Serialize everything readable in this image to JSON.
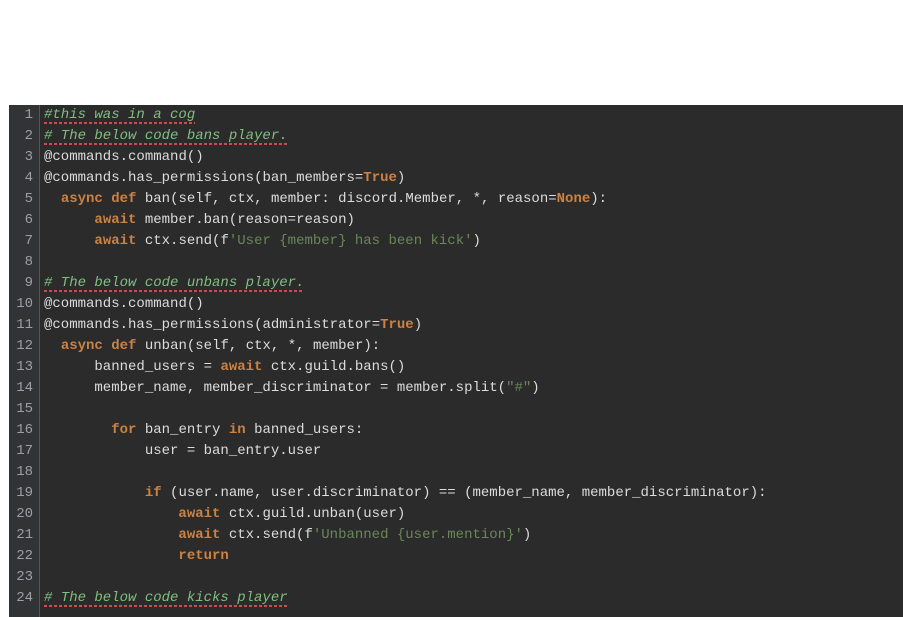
{
  "editor": {
    "total_lines": 24,
    "lines": [
      {
        "num": 1,
        "segments": [
          {
            "cls": "tok-comment squiggle",
            "text": "#this was in a cog"
          }
        ]
      },
      {
        "num": 2,
        "segments": [
          {
            "cls": "tok-comment squiggle",
            "text": "# The below code bans player."
          }
        ]
      },
      {
        "num": 3,
        "segments": [
          {
            "cls": "tok-decor2",
            "text": "@commands"
          },
          {
            "cls": "tok-punct",
            "text": "."
          },
          {
            "cls": "tok-def",
            "text": "command"
          },
          {
            "cls": "tok-punct",
            "text": "()"
          }
        ]
      },
      {
        "num": 4,
        "segments": [
          {
            "cls": "tok-decor2",
            "text": "@commands"
          },
          {
            "cls": "tok-punct",
            "text": "."
          },
          {
            "cls": "tok-def",
            "text": "has_permissions"
          },
          {
            "cls": "tok-punct",
            "text": "("
          },
          {
            "cls": "tok-param",
            "text": "ban_members"
          },
          {
            "cls": "tok-punct",
            "text": "="
          },
          {
            "cls": "tok-kw",
            "text": "True"
          },
          {
            "cls": "tok-punct",
            "text": ")"
          }
        ]
      },
      {
        "num": 5,
        "segments": [
          {
            "cls": "",
            "text": "  "
          },
          {
            "cls": "tok-kw",
            "text": "async"
          },
          {
            "cls": "",
            "text": " "
          },
          {
            "cls": "tok-kw",
            "text": "def"
          },
          {
            "cls": "",
            "text": " "
          },
          {
            "cls": "tok-def",
            "text": "ban"
          },
          {
            "cls": "tok-punct",
            "text": "("
          },
          {
            "cls": "tok-param",
            "text": "self"
          },
          {
            "cls": "tok-punct",
            "text": ", "
          },
          {
            "cls": "tok-param",
            "text": "ctx"
          },
          {
            "cls": "tok-punct",
            "text": ", "
          },
          {
            "cls": "tok-param",
            "text": "member"
          },
          {
            "cls": "tok-punct",
            "text": ": "
          },
          {
            "cls": "tok-def",
            "text": "discord.Member"
          },
          {
            "cls": "tok-punct",
            "text": ", *, "
          },
          {
            "cls": "tok-param",
            "text": "reason"
          },
          {
            "cls": "tok-punct",
            "text": "="
          },
          {
            "cls": "tok-kw",
            "text": "None"
          },
          {
            "cls": "tok-punct",
            "text": "):"
          }
        ]
      },
      {
        "num": 6,
        "segments": [
          {
            "cls": "",
            "text": "      "
          },
          {
            "cls": "tok-kw",
            "text": "await"
          },
          {
            "cls": "",
            "text": " member.ban(reason=reason)"
          }
        ]
      },
      {
        "num": 7,
        "segments": [
          {
            "cls": "",
            "text": "      "
          },
          {
            "cls": "tok-kw",
            "text": "await"
          },
          {
            "cls": "",
            "text": " ctx.send("
          },
          {
            "cls": "tok-punct",
            "text": "f"
          },
          {
            "cls": "tok-str",
            "text": "'User {member} has been kick'"
          },
          {
            "cls": "",
            "text": ")"
          }
        ]
      },
      {
        "num": 8,
        "segments": []
      },
      {
        "num": 9,
        "segments": [
          {
            "cls": "tok-comment squiggle",
            "text": "# The below code unbans player."
          }
        ]
      },
      {
        "num": 10,
        "segments": [
          {
            "cls": "tok-decor2",
            "text": "@commands"
          },
          {
            "cls": "tok-punct",
            "text": "."
          },
          {
            "cls": "tok-def",
            "text": "command"
          },
          {
            "cls": "tok-punct",
            "text": "()"
          }
        ]
      },
      {
        "num": 11,
        "segments": [
          {
            "cls": "tok-decor2",
            "text": "@commands"
          },
          {
            "cls": "tok-punct",
            "text": "."
          },
          {
            "cls": "tok-def",
            "text": "has_permissions"
          },
          {
            "cls": "tok-punct",
            "text": "("
          },
          {
            "cls": "tok-param",
            "text": "administrator"
          },
          {
            "cls": "tok-punct",
            "text": "="
          },
          {
            "cls": "tok-kw",
            "text": "True"
          },
          {
            "cls": "tok-punct",
            "text": ")"
          }
        ]
      },
      {
        "num": 12,
        "segments": [
          {
            "cls": "",
            "text": "  "
          },
          {
            "cls": "tok-kw",
            "text": "async"
          },
          {
            "cls": "",
            "text": " "
          },
          {
            "cls": "tok-kw",
            "text": "def"
          },
          {
            "cls": "",
            "text": " "
          },
          {
            "cls": "tok-def",
            "text": "unban"
          },
          {
            "cls": "tok-punct",
            "text": "("
          },
          {
            "cls": "tok-param",
            "text": "self"
          },
          {
            "cls": "tok-punct",
            "text": ", "
          },
          {
            "cls": "tok-param",
            "text": "ctx"
          },
          {
            "cls": "tok-punct",
            "text": ", *, "
          },
          {
            "cls": "tok-param",
            "text": "member"
          },
          {
            "cls": "tok-punct",
            "text": "):"
          }
        ]
      },
      {
        "num": 13,
        "segments": [
          {
            "cls": "",
            "text": "      banned_users = "
          },
          {
            "cls": "tok-kw",
            "text": "await"
          },
          {
            "cls": "",
            "text": " ctx.guild.bans()"
          }
        ]
      },
      {
        "num": 14,
        "segments": [
          {
            "cls": "",
            "text": "      member_name, member_discriminator = member.split("
          },
          {
            "cls": "tok-str",
            "text": "\"#\""
          },
          {
            "cls": "",
            "text": ")"
          }
        ]
      },
      {
        "num": 15,
        "segments": []
      },
      {
        "num": 16,
        "segments": [
          {
            "cls": "",
            "text": "        "
          },
          {
            "cls": "tok-kw",
            "text": "for"
          },
          {
            "cls": "",
            "text": " ban_entry "
          },
          {
            "cls": "tok-kw",
            "text": "in"
          },
          {
            "cls": "",
            "text": " banned_users:"
          }
        ]
      },
      {
        "num": 17,
        "segments": [
          {
            "cls": "",
            "text": "            user = ban_entry.user"
          }
        ]
      },
      {
        "num": 18,
        "segments": []
      },
      {
        "num": 19,
        "segments": [
          {
            "cls": "",
            "text": "            "
          },
          {
            "cls": "tok-kw",
            "text": "if"
          },
          {
            "cls": "",
            "text": " (user.name, user.discriminator) == (member_name, member_discriminator):"
          }
        ]
      },
      {
        "num": 20,
        "segments": [
          {
            "cls": "",
            "text": "                "
          },
          {
            "cls": "tok-kw",
            "text": "await"
          },
          {
            "cls": "",
            "text": " ctx.guild.unban(user)"
          }
        ]
      },
      {
        "num": 21,
        "segments": [
          {
            "cls": "",
            "text": "                "
          },
          {
            "cls": "tok-kw",
            "text": "await"
          },
          {
            "cls": "",
            "text": " ctx.send("
          },
          {
            "cls": "tok-punct",
            "text": "f"
          },
          {
            "cls": "tok-str",
            "text": "'Unbanned {user.mention}'"
          },
          {
            "cls": "",
            "text": ")"
          }
        ]
      },
      {
        "num": 22,
        "segments": [
          {
            "cls": "",
            "text": "                "
          },
          {
            "cls": "tok-kw",
            "text": "return"
          }
        ]
      },
      {
        "num": 23,
        "segments": []
      },
      {
        "num": 24,
        "segments": [
          {
            "cls": "tok-comment squiggle",
            "text": "# The below code kicks player"
          }
        ]
      }
    ]
  }
}
